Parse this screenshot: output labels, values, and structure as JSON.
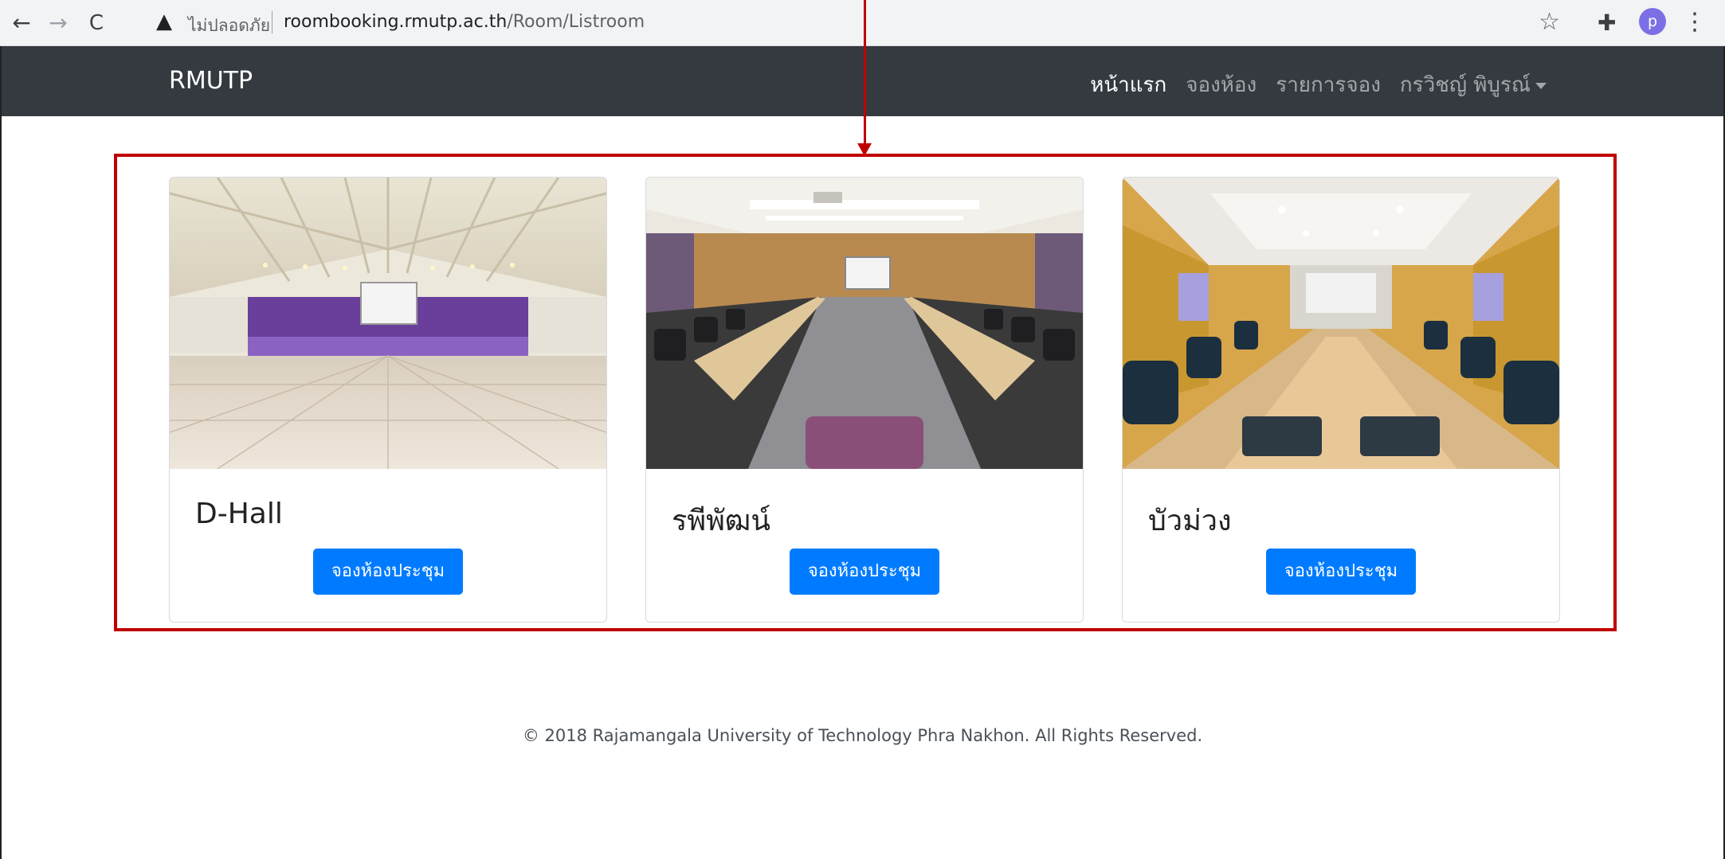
{
  "browser": {
    "security_warning": "ไม่ปลอดภัย",
    "url_domain": "roombooking.rmutp.ac.th",
    "url_path": "/Room/Listroom",
    "profile_initial": "p"
  },
  "navbar": {
    "brand": "RMUTP",
    "links": [
      "หน้าแรก",
      "จองห้อง",
      "รายการจอง",
      "กรวิชญ์ พิบูรณ์"
    ]
  },
  "rooms": [
    {
      "name": "D-Hall",
      "button": "จองห้องประชุม"
    },
    {
      "name": "รพีพัฒน์",
      "button": "จองห้องประชุม"
    },
    {
      "name": "บัวม่วง",
      "button": "จองห้องประชุม"
    }
  ],
  "footer": {
    "text": "© 2018 Rajamangala University of Technology Phra Nakhon. All Rights Reserved."
  }
}
